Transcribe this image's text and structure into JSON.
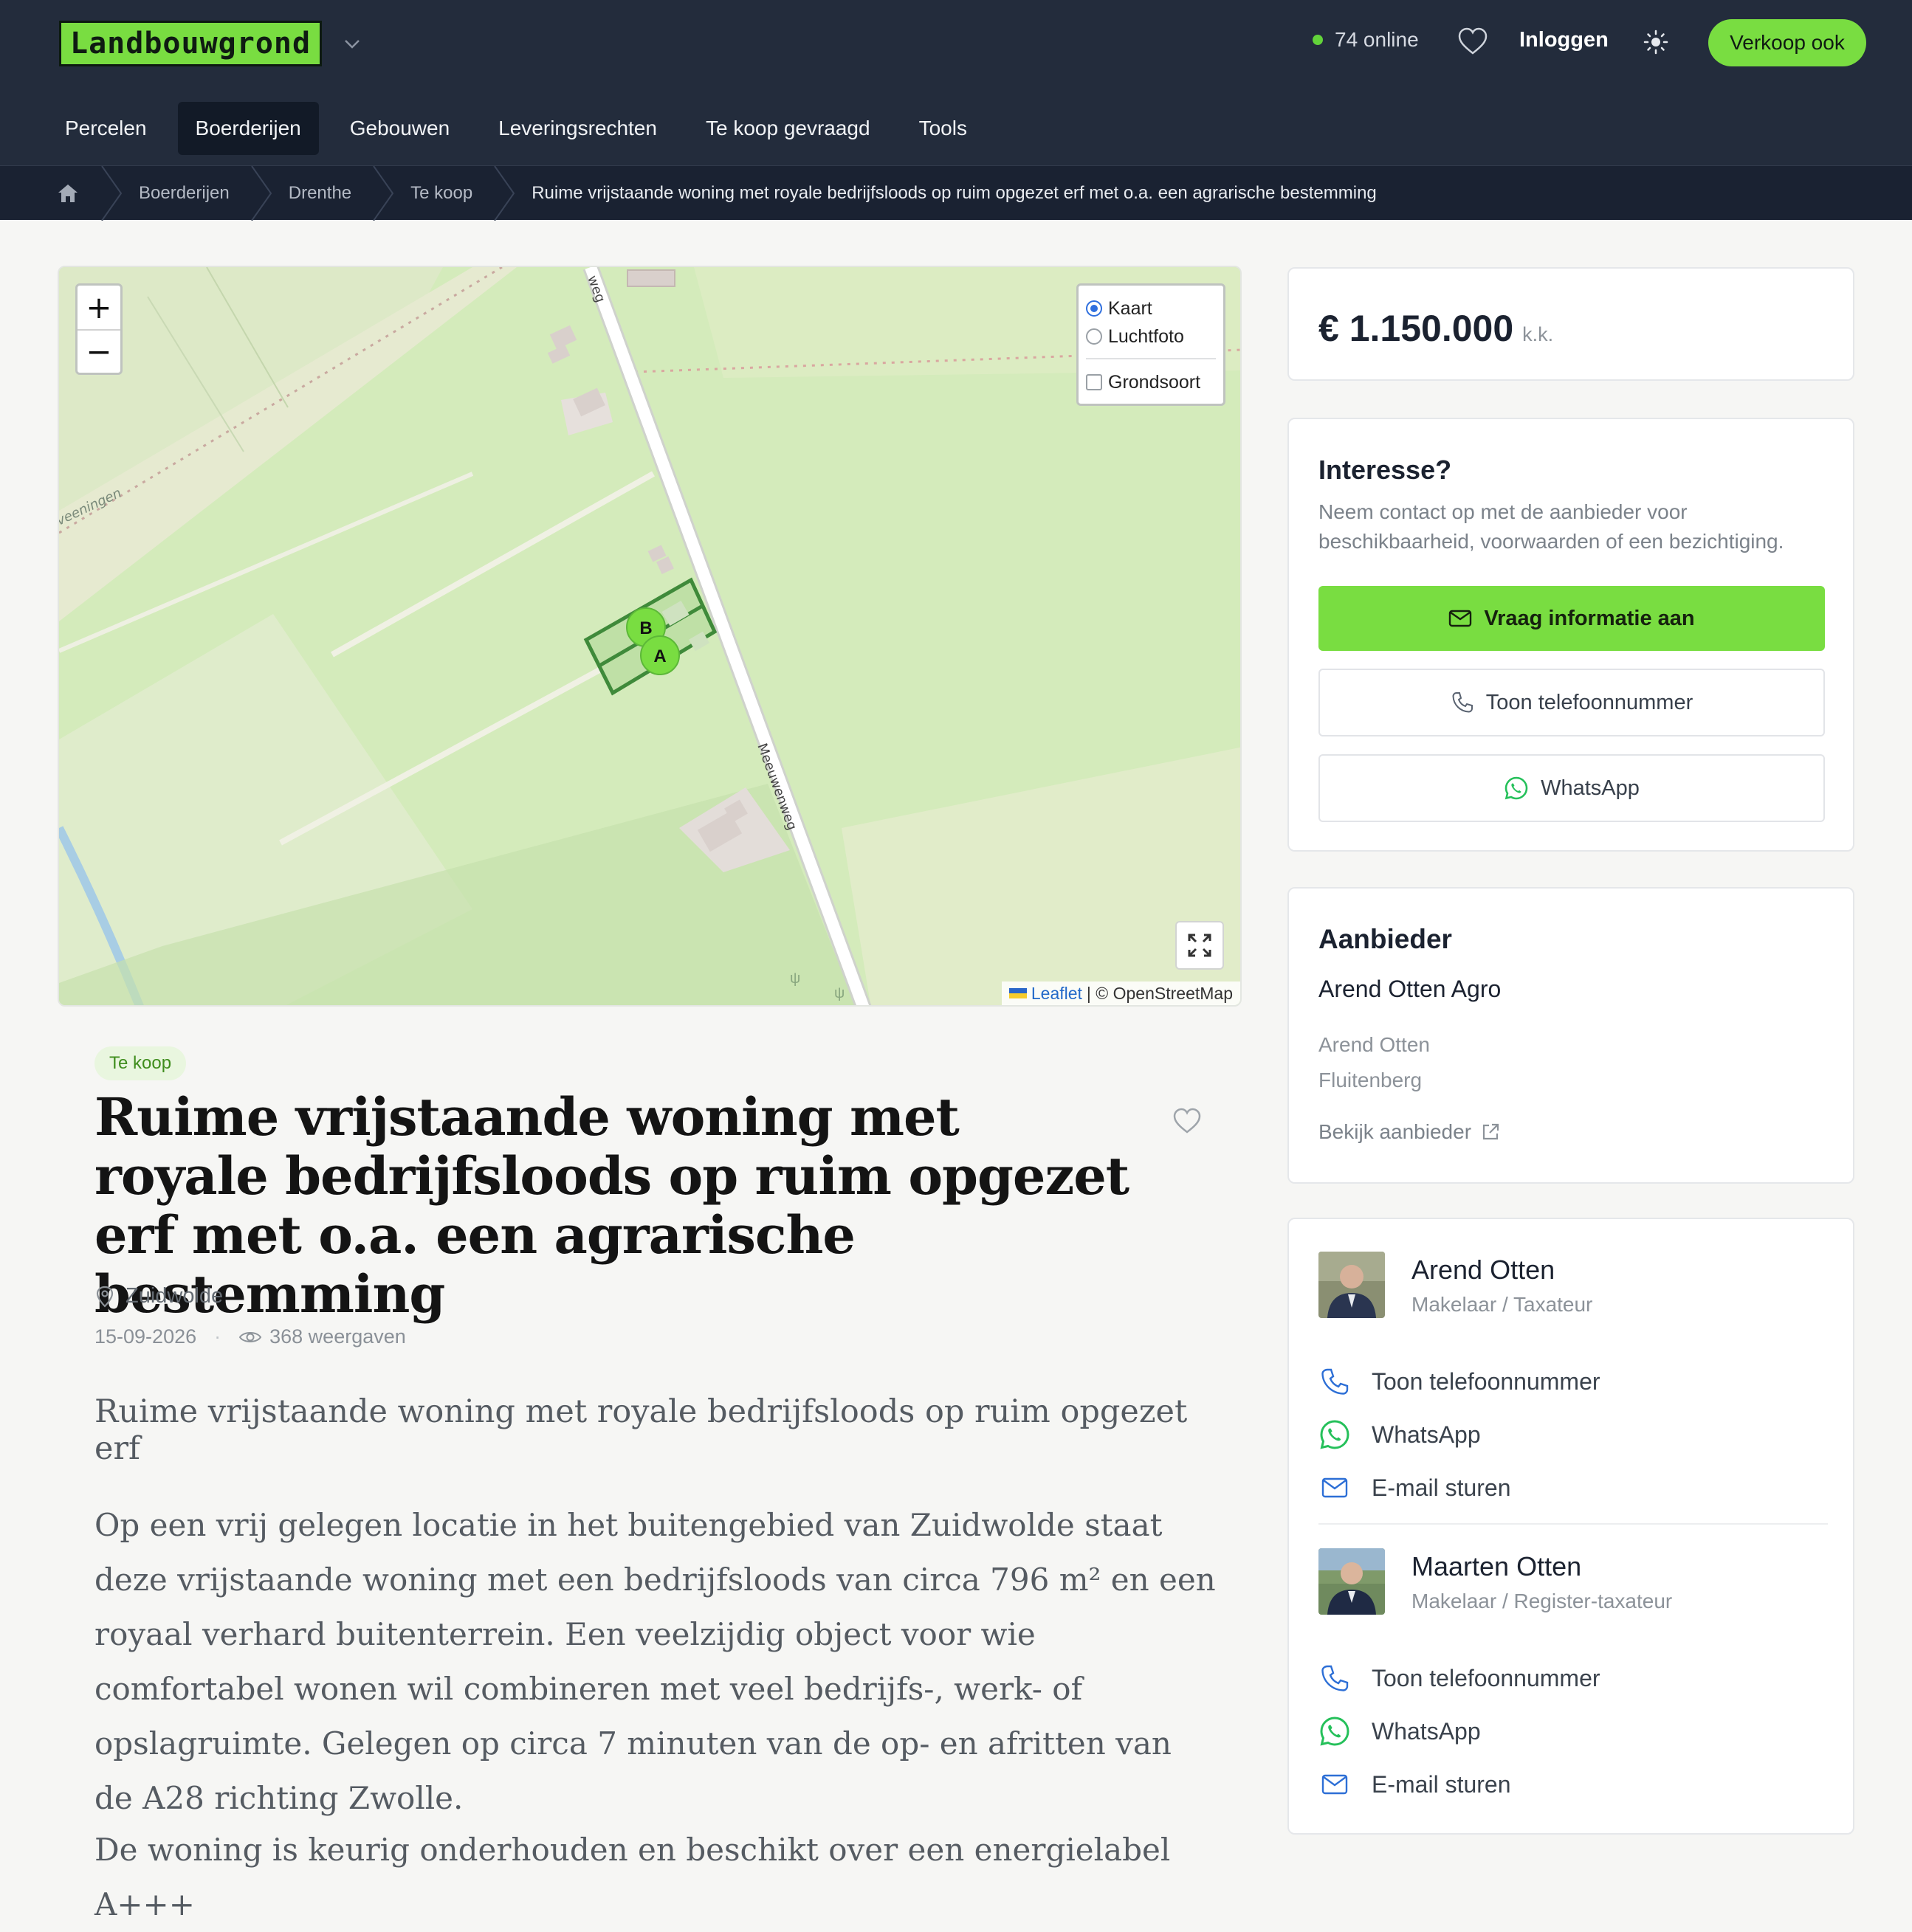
{
  "header": {
    "logo": "Landbouwgrond",
    "online": "74 online",
    "login": "Inloggen",
    "sell_button": "Verkoop ook",
    "nav": [
      "Percelen",
      "Boerderijen",
      "Gebouwen",
      "Leveringsrechten",
      "Te koop gevraagd",
      "Tools"
    ],
    "nav_active": "Boerderijen",
    "accent_color": "#79dd41",
    "bar_color": "#232c3c"
  },
  "breadcrumb": [
    "Boerderijen",
    "Drenthe",
    "Te koop",
    "Ruime vrijstaande woning met royale bedrijfsloods op ruim opgezet erf met o.a. een agrarische bestemming"
  ],
  "map": {
    "zoom_in": "+",
    "zoom_out": "−",
    "layers": {
      "kaart": "Kaart",
      "luchtfoto": "Luchtfoto",
      "grondsoort": "Grondsoort",
      "selected": "Kaart"
    },
    "markers": [
      "B",
      "A"
    ],
    "street_labels": [
      "Meeuwenweg",
      "weg",
      "veeningen"
    ],
    "attribution_link": "Leaflet",
    "attribution_text": "| © OpenStreetMap"
  },
  "listing": {
    "badge": "Te koop",
    "title": "Ruime vrijstaande woning met royale bedrijfsloods op ruim opgezet erf met o.a. een agrarische bestemming",
    "location": "Zuidwolde",
    "date": "15-09-2026",
    "views": "368 weergaven",
    "lead": "Ruime vrijstaande woning met royale bedrijfsloods op ruim opgezet erf",
    "paragraph": "Op een vrij gelegen locatie in het buitengebied van Zuidwolde staat deze vrijstaande woning met een bedrijfsloods van circa 796 m² en een royaal verhard buitenterrein. Een veelzijdig object voor wie comfortabel wonen wil combineren met veel bedrijfs-, werk- of opslagruimte. Gelegen op circa 7 minuten van de op- en afritten van de A28 richting Zwolle.",
    "paragraph2": "De woning is keurig onderhouden en beschikt over een energielabel A+++"
  },
  "sidebar": {
    "price": "€ 1.150.000",
    "price_suffix": "k.k.",
    "interest_title": "Interesse?",
    "interest_text": "Neem contact op met de aanbieder voor beschikbaarheid, voorwaarden of een bezichtiging.",
    "request_info": "Vraag informatie aan",
    "show_phone": "Toon telefoonnummer",
    "whatsapp": "WhatsApp",
    "provider_title": "Aanbieder",
    "provider_name": "Arend Otten Agro",
    "provider_person": "Arend Otten",
    "provider_place": "Fluitenberg",
    "provider_link": "Bekijk aanbieder",
    "agents": [
      {
        "name": "Arend Otten",
        "role": "Makelaar / Taxateur",
        "phone": "Toon telefoonnummer",
        "whatsapp": "WhatsApp",
        "email": "E-mail sturen"
      },
      {
        "name": "Maarten Otten",
        "role": "Makelaar / Register-taxateur",
        "phone": "Toon telefoonnummer",
        "whatsapp": "WhatsApp",
        "email": "E-mail sturen"
      }
    ]
  }
}
